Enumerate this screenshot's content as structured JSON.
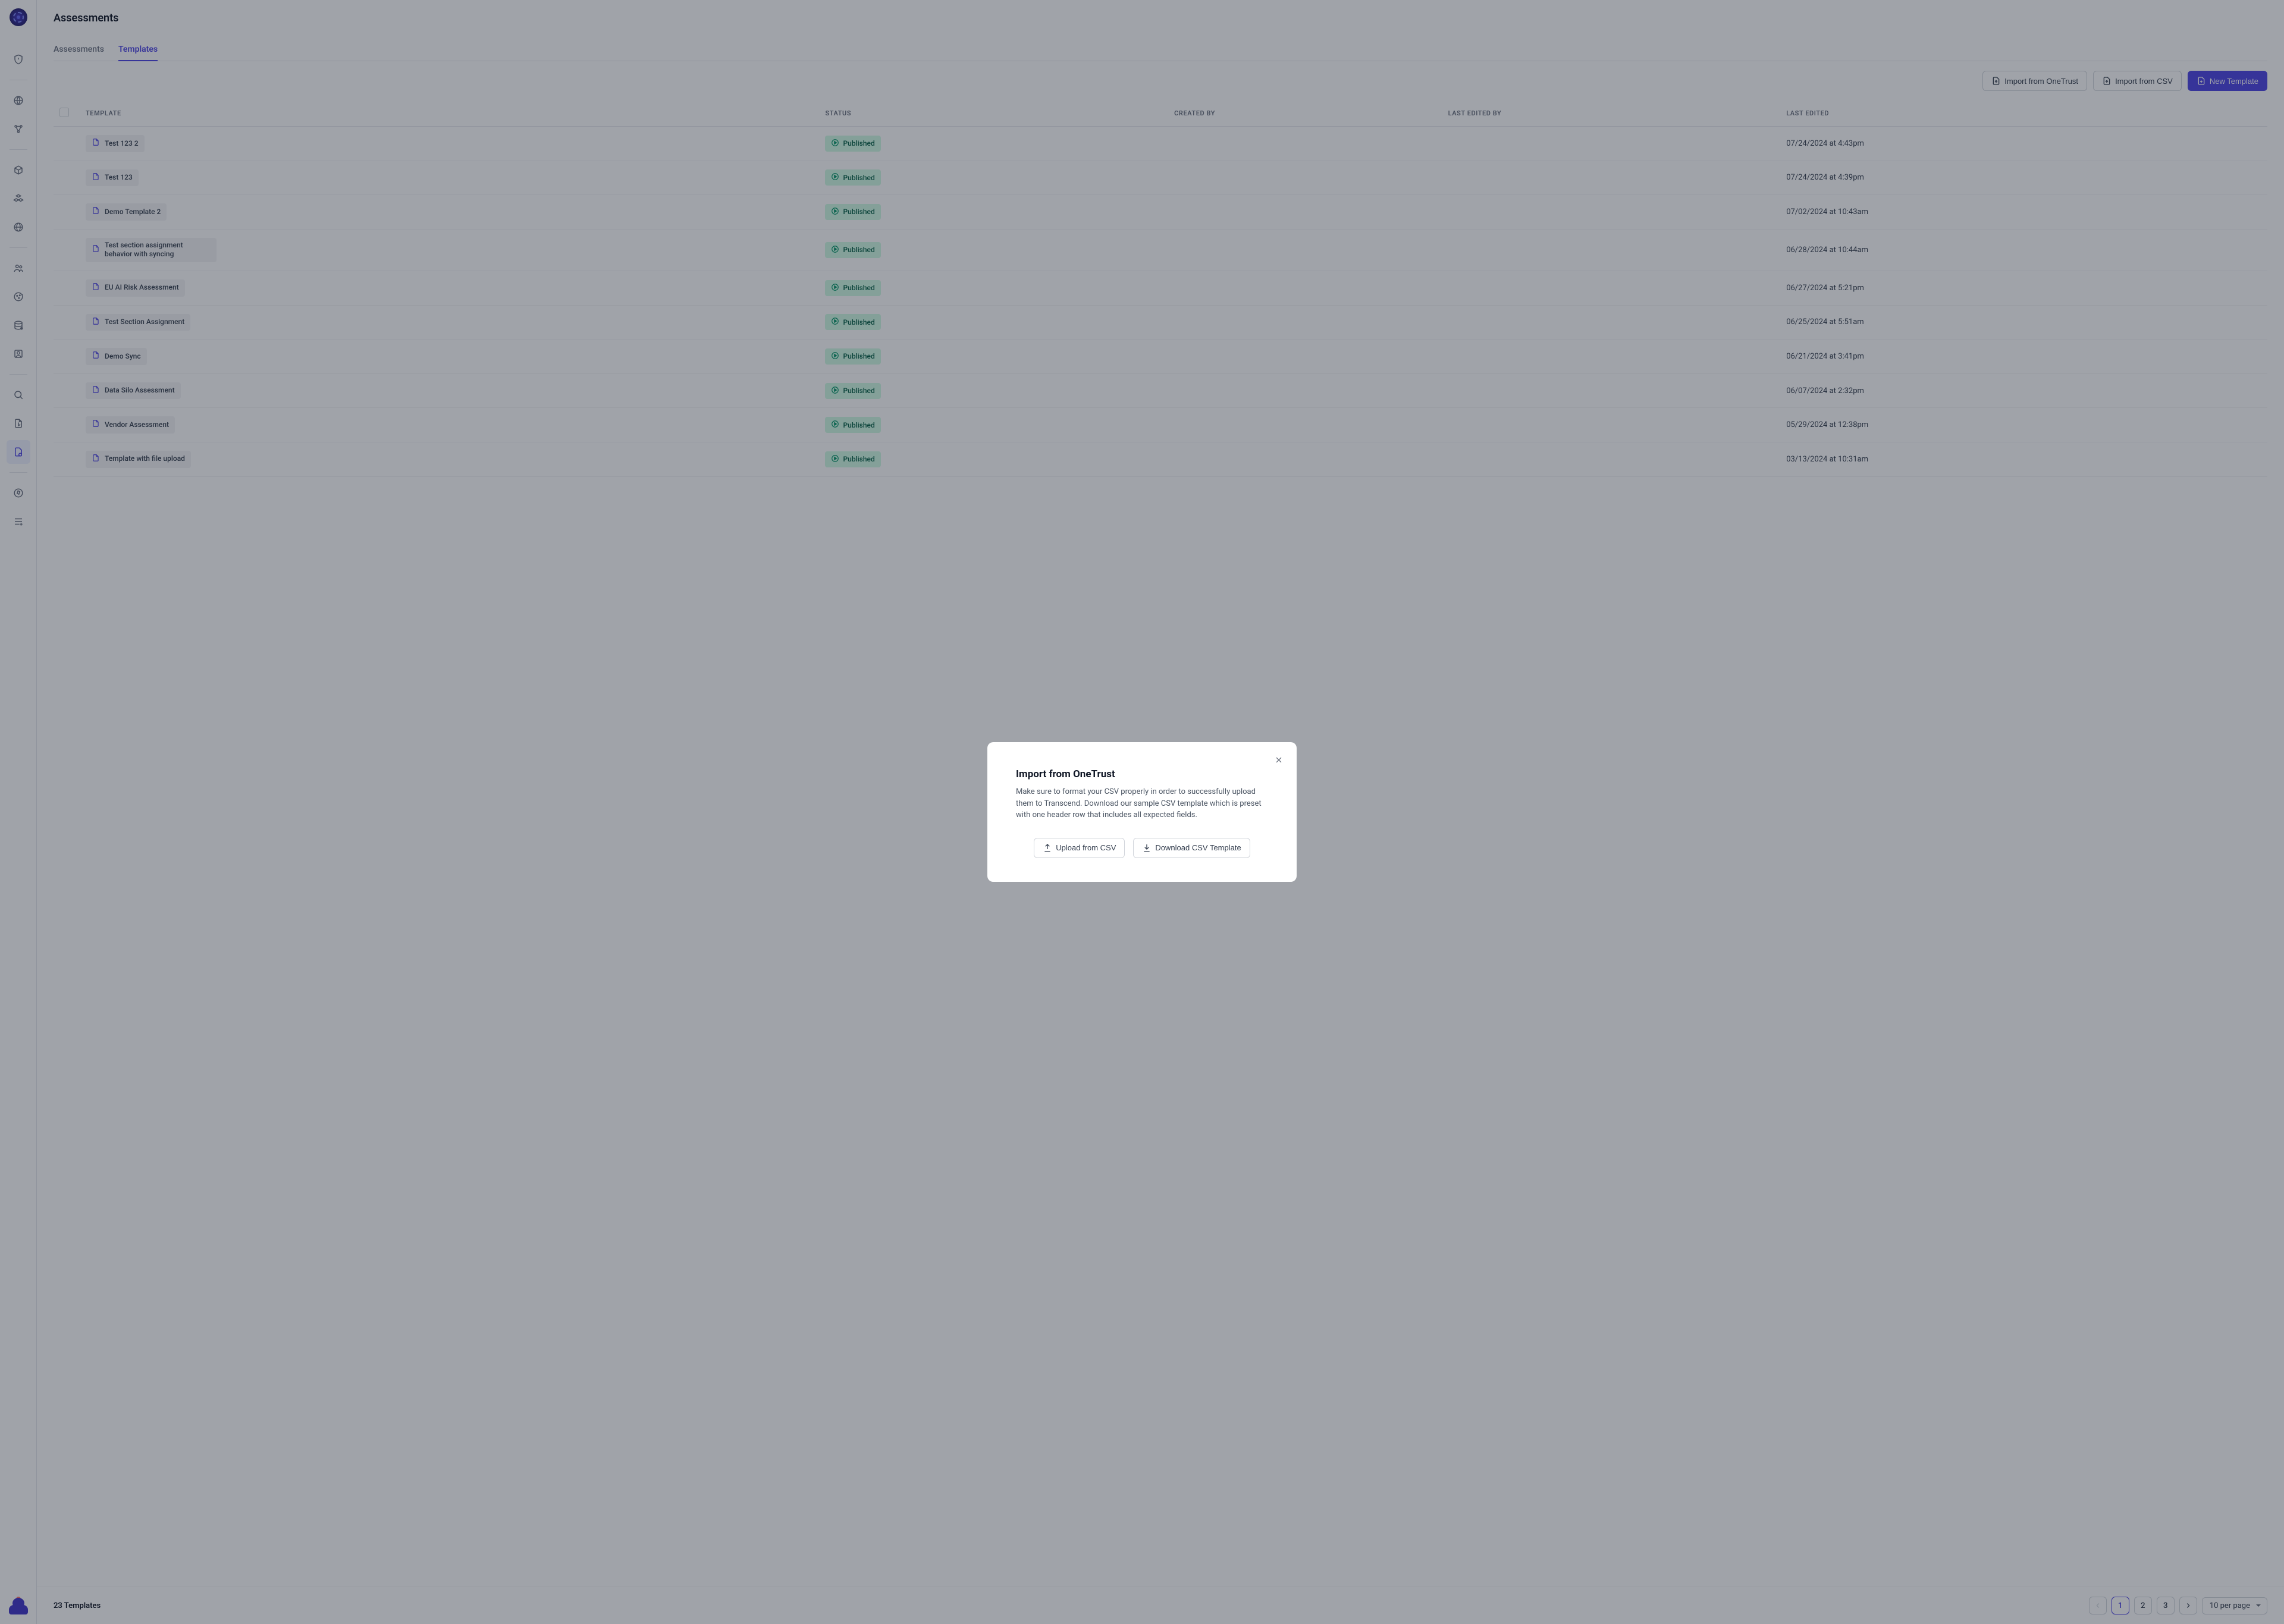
{
  "page": {
    "title": "Assessments"
  },
  "tabs": [
    {
      "label": "Assessments",
      "active": false
    },
    {
      "label": "Templates",
      "active": true
    }
  ],
  "toolbar": {
    "import_onetrust": "Import from OneTrust",
    "import_csv": "Import from CSV",
    "new_template": "New Template"
  },
  "table": {
    "headers": {
      "template": "TEMPLATE",
      "status": "STATUS",
      "created_by": "CREATED BY",
      "last_edited_by": "LAST EDITED BY",
      "last_edited": "LAST EDITED"
    },
    "rows": [
      {
        "name": "Test 123 2",
        "status": "Published",
        "created_by": "",
        "last_edited_by": "",
        "last_edited": "07/24/2024 at 4:43pm"
      },
      {
        "name": "Test 123",
        "status": "Published",
        "created_by": "",
        "last_edited_by": "",
        "last_edited": "07/24/2024 at 4:39pm"
      },
      {
        "name": "Demo Template 2",
        "status": "Published",
        "created_by": "",
        "last_edited_by": "",
        "last_edited": "07/02/2024 at 10:43am"
      },
      {
        "name": "Test section assignment behavior with syncing",
        "status": "Published",
        "created_by": "",
        "last_edited_by": "",
        "last_edited": "06/28/2024 at 10:44am"
      },
      {
        "name": "EU AI Risk Assessment",
        "status": "Published",
        "created_by": "",
        "last_edited_by": "",
        "last_edited": "06/27/2024 at 5:21pm"
      },
      {
        "name": "Test Section Assignment",
        "status": "Published",
        "created_by": "",
        "last_edited_by": "",
        "last_edited": "06/25/2024 at 5:51am"
      },
      {
        "name": "Demo Sync",
        "status": "Published",
        "created_by": "",
        "last_edited_by": "",
        "last_edited": "06/21/2024 at 3:41pm"
      },
      {
        "name": "Data Silo Assessment",
        "status": "Published",
        "created_by": "",
        "last_edited_by": "",
        "last_edited": "06/07/2024 at 2:32pm"
      },
      {
        "name": "Vendor Assessment",
        "status": "Published",
        "created_by": "",
        "last_edited_by": "",
        "last_edited": "05/29/2024 at 12:38pm"
      },
      {
        "name": "Template with file upload",
        "status": "Published",
        "created_by": "",
        "last_edited_by": "",
        "last_edited": "03/13/2024 at 10:31am"
      }
    ]
  },
  "footer": {
    "count": "23 Templates",
    "pages": [
      "1",
      "2",
      "3"
    ],
    "current_page": "1",
    "per_page": "10 per page"
  },
  "modal": {
    "title": "Import from OneTrust",
    "body": "Make sure to format your CSV properly in order to successfully upload them to Transcend. Download our sample CSV template which is preset with one header row that includes all expected fields.",
    "upload_label": "Upload from CSV",
    "download_label": "Download CSV Template"
  },
  "sidebar_items": [
    {
      "name": "shield-icon"
    },
    {
      "name": "globe-icon"
    },
    {
      "name": "nodes-icon"
    },
    {
      "name": "cube-icon"
    },
    {
      "name": "cubes-icon"
    },
    {
      "name": "world-icon"
    },
    {
      "name": "people-icon"
    },
    {
      "name": "cookie-icon"
    },
    {
      "name": "database-icon"
    },
    {
      "name": "user-square-icon"
    },
    {
      "name": "search-doc-icon"
    },
    {
      "name": "file-export-icon"
    },
    {
      "name": "file-gear-icon"
    },
    {
      "name": "compass-icon"
    },
    {
      "name": "list-plus-icon"
    }
  ]
}
